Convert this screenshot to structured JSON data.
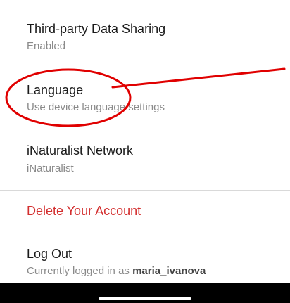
{
  "settings": {
    "items": [
      {
        "title": "Third-party Data Sharing",
        "subtitle": "Enabled"
      },
      {
        "title": "Language",
        "subtitle": "Use device language settings"
      },
      {
        "title": "iNaturalist Network",
        "subtitle": "iNaturalist"
      },
      {
        "title": "Delete Your Account"
      },
      {
        "title": "Log Out",
        "subtitle_prefix": "Currently logged in as ",
        "subtitle_user": "maria_ivanova"
      }
    ]
  },
  "colors": {
    "danger_text": "#d32f2f",
    "annotation_red": "#e00000",
    "divider": "#d9d9d9"
  }
}
